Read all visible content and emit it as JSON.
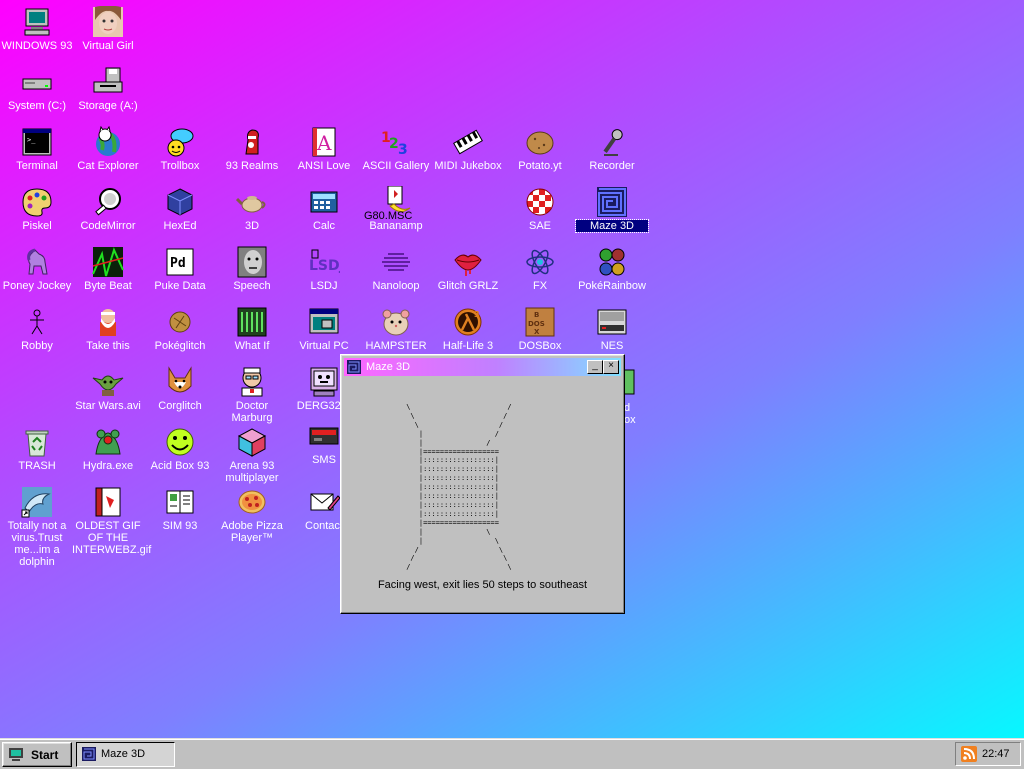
{
  "desktop": {
    "icons": [
      {
        "id": "windows93",
        "label": "WINDOWS 93",
        "icon": "computer-icon"
      },
      {
        "id": "virtual-girl",
        "label": "Virtual Girl",
        "icon": "face-icon"
      },
      {
        "id": "system-c",
        "label": "System (C:)",
        "icon": "drive-icon"
      },
      {
        "id": "storage-a",
        "label": "Storage (A:)",
        "icon": "floppy-drive-icon"
      },
      {
        "id": "terminal",
        "label": "Terminal",
        "icon": "terminal-icon"
      },
      {
        "id": "cat-explorer",
        "label": "Cat Explorer",
        "icon": "globe-cat-icon"
      },
      {
        "id": "trollbox",
        "label": "Trollbox",
        "icon": "chat-bubble-icon"
      },
      {
        "id": "93-realms",
        "label": "93 Realms",
        "icon": "knight-icon"
      },
      {
        "id": "ansi-love",
        "label": "ANSI Love",
        "icon": "letter-a-icon"
      },
      {
        "id": "ascii-gallery",
        "label": "ASCII Gallery",
        "icon": "numbers-icon"
      },
      {
        "id": "midi-jukebox",
        "label": "MIDI Jukebox",
        "icon": "piano-icon"
      },
      {
        "id": "potato",
        "label": "Potato.yt",
        "icon": "potato-icon"
      },
      {
        "id": "recorder",
        "label": "Recorder",
        "icon": "microphone-icon"
      },
      {
        "id": "piskel",
        "label": "Piskel",
        "icon": "palette-icon"
      },
      {
        "id": "codemirror",
        "label": "CodeMirror",
        "icon": "mirror-icon"
      },
      {
        "id": "hexed",
        "label": "HexEd",
        "icon": "cube-icon"
      },
      {
        "id": "3d",
        "label": "3D",
        "icon": "teapot-icon"
      },
      {
        "id": "calc",
        "label": "Calc",
        "icon": "calculator-icon"
      },
      {
        "id": "bananamp",
        "label": "Bananamp",
        "icon": "banana-icon",
        "extra": "G80.MSC"
      },
      {
        "id": "sae",
        "label": "SAE",
        "icon": "checker-ball-icon"
      },
      {
        "id": "maze-3d",
        "label": "Maze 3D",
        "icon": "maze-icon",
        "selected": true
      },
      {
        "id": "poney-jockey",
        "label": "Poney Jockey",
        "icon": "pony-icon"
      },
      {
        "id": "byte-beat",
        "label": "Byte Beat",
        "icon": "waveform-icon"
      },
      {
        "id": "puke-data",
        "label": "Puke Data",
        "icon": "pd-icon"
      },
      {
        "id": "speech",
        "label": "Speech",
        "icon": "speech-face-icon"
      },
      {
        "id": "lsdj",
        "label": "LSDJ",
        "icon": "lsdj-icon"
      },
      {
        "id": "nanoloop",
        "label": "Nanoloop",
        "icon": "nanoloop-icon"
      },
      {
        "id": "glitch-grlz",
        "label": "Glitch GRLZ",
        "icon": "lips-icon"
      },
      {
        "id": "fx",
        "label": "FX",
        "icon": "atom-icon"
      },
      {
        "id": "pokerainbow",
        "label": "PokéRainbow",
        "icon": "pokemon-icon"
      },
      {
        "id": "robby",
        "label": "Robby",
        "icon": "stick-figure-icon"
      },
      {
        "id": "take-this",
        "label": "Take this",
        "icon": "old-man-icon"
      },
      {
        "id": "pokeglitch",
        "label": "Pokéglitch",
        "icon": "glitch-ball-icon"
      },
      {
        "id": "what-if",
        "label": "What If",
        "icon": "bars-icon"
      },
      {
        "id": "virtual-pc",
        "label": "Virtual PC",
        "icon": "window-app-icon"
      },
      {
        "id": "hampster",
        "label": "HAMPSTER",
        "icon": "hamster-icon"
      },
      {
        "id": "half-life-3",
        "label": "Half-Life 3",
        "icon": "lambda-icon"
      },
      {
        "id": "dosbox",
        "label": "DOSBox",
        "icon": "dosbox-icon"
      },
      {
        "id": "nes",
        "label": "NES",
        "icon": "nes-icon"
      },
      {
        "id": "star-wars",
        "label": "Star Wars.avi",
        "icon": "yoda-icon"
      },
      {
        "id": "corglitch",
        "label": "Corglitch",
        "icon": "corgi-icon"
      },
      {
        "id": "doctor-marburg",
        "label": "Doctor Marburg",
        "icon": "doctor-icon"
      },
      {
        "id": "derg32",
        "label": "DERG32.E",
        "icon": "robot-screen-icon"
      },
      {
        "id": "trash",
        "label": "TRASH",
        "icon": "recycle-bin-icon"
      },
      {
        "id": "hydra",
        "label": "Hydra.exe",
        "icon": "hydra-icon"
      },
      {
        "id": "acid-box",
        "label": "Acid Box 93",
        "icon": "smiley-icon"
      },
      {
        "id": "arena-93",
        "label": "Arena 93 multiplayer",
        "icon": "cube-color-icon"
      },
      {
        "id": "sms",
        "label": "SMS",
        "icon": "sms-console-icon"
      },
      {
        "id": "dolphin",
        "label": "Totally not a virus.Trust me...im a dolphin",
        "icon": "dolphin-icon"
      },
      {
        "id": "oldest-gif",
        "label": "OLDEST GIF OF THE INTERWEBZ.gif",
        "icon": "gif-file-icon"
      },
      {
        "id": "sim93",
        "label": "SIM 93",
        "icon": "book-icon"
      },
      {
        "id": "adobe-pizza",
        "label": "Adobe Pizza Player™",
        "icon": "pizza-icon"
      },
      {
        "id": "contact",
        "label": "Contact",
        "icon": "mail-pen-icon"
      }
    ],
    "partial": {
      "right_of_window_1": "d",
      "right_of_window_2": "ox"
    }
  },
  "maze_window": {
    "title": "Maze 3D",
    "minimize_label": "_",
    "close_label": "×",
    "view": " \\                       /\n  \\                     /\n   \\                   /\n    |                 /\n    |               /\n    |==================\n    |:::::::::::::::::|\n    |:::::::::::::::::|\n    |:::::::::::::::::|\n    |:::::::::::::::::|\n    |:::::::::::::::::|\n    |:::::::::::::::::|\n    |:::::::::::::::::|\n    |==================\n    |               \\\n    |                 \\\n   /                   \\\n  /                     \\\n /                       \\",
    "status": "Facing west, exit lies 50 steps to southeast"
  },
  "taskbar": {
    "start_label": "Start",
    "tasks": [
      {
        "label": "Maze 3D"
      }
    ],
    "clock": "22:47"
  },
  "colors": {
    "selection": "#000080",
    "face": "#c0c0c0"
  }
}
